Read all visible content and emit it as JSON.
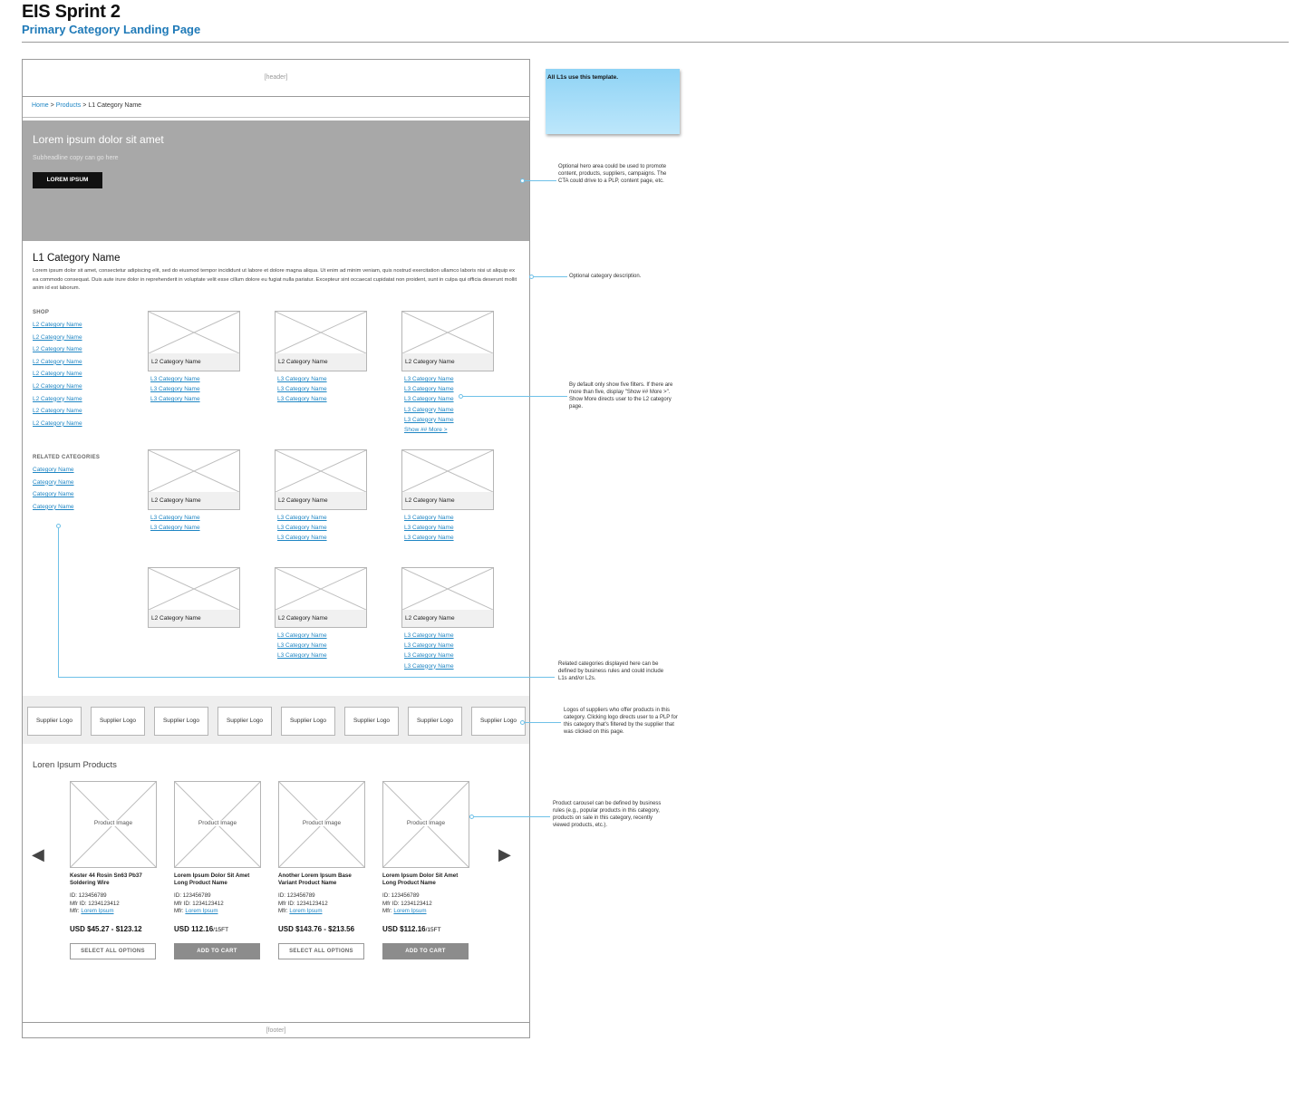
{
  "doc": {
    "title": "EIS Sprint 2",
    "subtitle": "Primary Category Landing Page"
  },
  "header": {
    "label": "[header]"
  },
  "footer": {
    "label": "[footer]"
  },
  "breadcrumb": {
    "home": "Home",
    "sep1": ">",
    "products": "Products",
    "sep2": ">",
    "current": "L1 Category Name"
  },
  "hero": {
    "headline": "Lorem ipsum dolor sit amet",
    "subheadline": "Subheadline copy can go here",
    "cta": "LOREM IPSUM"
  },
  "category": {
    "title": "L1 Category Name",
    "description": "Lorem ipsum dolor sit amet, consectetur adipiscing elit, sed do eiusmod tempor incididunt ut labore et dolore magna aliqua. Ut enim ad minim veniam, quis nostrud exercitation ullamco laboris nisi ut aliquip ex ea commodo consequat. Duis aute irure dolor in reprehenderit in voluptate velit esse cillum dolore eu fugiat nulla pariatur. Excepteur sint occaecat cupidatat non proident, sunt in culpa qui officia deserunt mollit anim id est laborum."
  },
  "sidebar": {
    "shop_heading": "SHOP",
    "shop_items": [
      "L2 Category Name",
      "L2 Category Name",
      "L2 Category Name",
      "L2 Category Name",
      "L2 Category Name",
      "L2 Category Name",
      "L2 Category Name",
      "L2 Category Name",
      "L2 Category Name"
    ],
    "related_heading": "RELATED CATEGORIES",
    "related_items": [
      "Category Name",
      "Category Name",
      "Category Name",
      "Category Name"
    ]
  },
  "l2_tiles": [
    {
      "label": "L2 Category Name",
      "l3": [
        "L3 Category Name",
        "L3 Category Name",
        "L3 Category Name"
      ]
    },
    {
      "label": "L2 Category Name",
      "l3": [
        "L3 Category Name",
        "L3 Category Name",
        "L3 Category Name"
      ]
    },
    {
      "label": "L2 Category Name",
      "l3": [
        "L3 Category Name",
        "L3 Category Name",
        "L3 Category Name",
        "L3 Category Name",
        "L3 Category Name"
      ],
      "more": "Show ## More >"
    },
    {
      "label": "L2 Category Name",
      "l3": [
        "L3 Category Name",
        "L3 Category Name"
      ]
    },
    {
      "label": "L2 Category Name",
      "l3": [
        "L3 Category Name",
        "L3 Category Name",
        "L3 Category Name"
      ]
    },
    {
      "label": "L2 Category Name",
      "l3": [
        "L3 Category Name",
        "L3 Category Name",
        "L3 Category Name"
      ]
    },
    {
      "label": "L2 Category Name",
      "l3": []
    },
    {
      "label": "L2 Category Name",
      "l3": [
        "L3 Category Name",
        "L3 Category Name",
        "L3 Category Name"
      ]
    },
    {
      "label": "L2 Category Name",
      "l3": [
        "L3 Category Name",
        "L3 Category Name",
        "L3 Category Name",
        "L3 Category Name"
      ]
    }
  ],
  "suppliers": [
    "Supplier Logo",
    "Supplier Logo",
    "Supplier Logo",
    "Supplier Logo",
    "Supplier Logo",
    "Supplier Logo",
    "Supplier Logo",
    "Supplier Logo"
  ],
  "products_section": {
    "title": "Loren Ipsum Products",
    "prev_icon": "arrow-left-icon",
    "next_icon": "arrow-right-icon",
    "items": [
      {
        "image": "Product Image",
        "name": "Kester 44 Rosin Sn63 Pb37 Soldering Wire",
        "id": "ID: 123456789",
        "mfr_id": "Mfr ID: 1234123412",
        "mfr_label": "Mfr:",
        "mfr": "Lorem Ipsum",
        "price": "USD $45.27 - $123.12",
        "unit": "",
        "button": "SELECT ALL OPTIONS",
        "button_style": "outline"
      },
      {
        "image": "Product Image",
        "name": "Lorem Ipsum Dolor Sit Amet Long Product Name",
        "id": "ID: 123456789",
        "mfr_id": "Mfr ID: 1234123412",
        "mfr_label": "Mfr:",
        "mfr": "Lorem Ipsum",
        "price": "USD 112.16",
        "unit": "/15FT",
        "button": "ADD TO CART",
        "button_style": "fill"
      },
      {
        "image": "Product Image",
        "name": "Another Lorem Ipsum Base Variant Product Name",
        "id": "ID: 123456789",
        "mfr_id": "Mfr ID: 1234123412",
        "mfr_label": "Mfr:",
        "mfr": "Lorem Ipsum",
        "price": "USD $143.76 - $213.56",
        "unit": "",
        "button": "SELECT ALL OPTIONS",
        "button_style": "outline"
      },
      {
        "image": "Product Image",
        "name": "Lorem Ipsum Dolor Sit Amet Long Product Name",
        "id": "ID: 123456789",
        "mfr_id": "Mfr ID: 1234123412",
        "mfr_label": "Mfr:",
        "mfr": "Lorem Ipsum",
        "price": "USD $112.16",
        "unit": "/15FT",
        "button": "ADD TO CART",
        "button_style": "fill"
      }
    ]
  },
  "annotations": {
    "sticky": "All L1s use this template.",
    "hero_note": "Optional hero area could be used to promote content, products, suppliers, campaigns. The CTA could drive to a PLP, content page, etc.",
    "desc_note": "Optional category description.",
    "filters_note": "By default only show five filters. If there are more than five, display \"Show ## More >\". Show More directs user to the L2 category page.",
    "related_note": "Related categories displayed here can be defined by business rules and could include L1s and/or L2s.",
    "supplier_note": "Logos of suppliers who offer products in this category. Clicking logo directs user to a PLP for this category that's filtered by the supplier that was clicked on this page.",
    "carousel_note": "Product carousel can be defined by business rules (e.g., popular products in this category, products on sale in this category, recently viewed products, etc.)."
  },
  "colors": {
    "accent": "#1f7ab8",
    "link": "#1f86c4",
    "hero_bg": "#a8a8a8",
    "sticky": "#8fd3f5",
    "leader": "#6fc1e8"
  }
}
